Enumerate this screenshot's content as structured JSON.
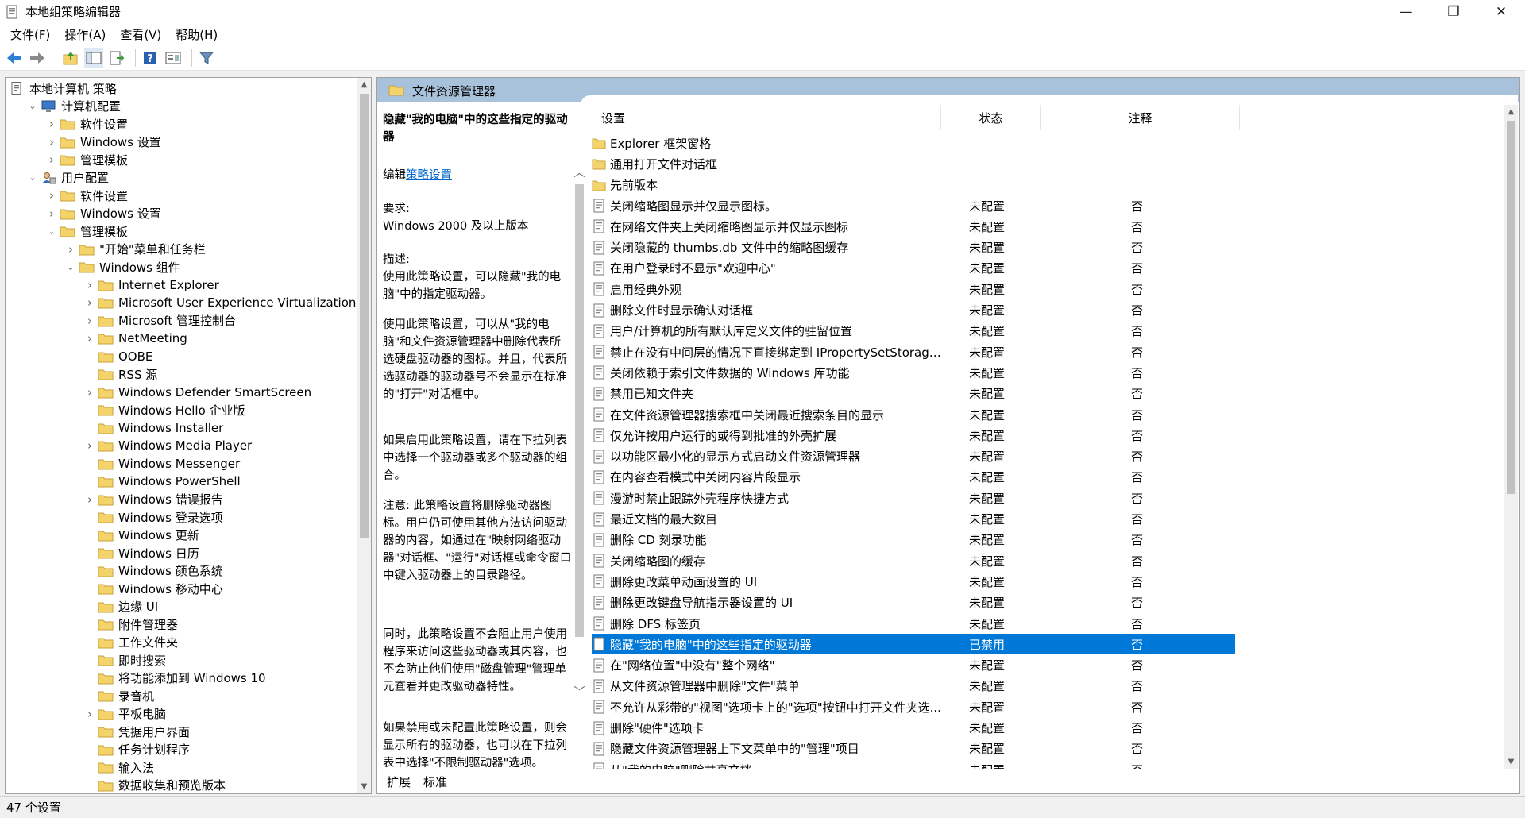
{
  "window": {
    "title": "本地组策略编辑器",
    "minimize": "—",
    "maximize": "❐",
    "close": "✕"
  },
  "menu": [
    "文件(F)",
    "操作(A)",
    "查看(V)",
    "帮助(H)"
  ],
  "tree": [
    {
      "label": "本地计算机 策略",
      "level": 0,
      "arrow": "",
      "icon": "policy-doc-icon"
    },
    {
      "label": "计算机配置",
      "level": 1,
      "arrow": "v",
      "icon": "computer-icon"
    },
    {
      "label": "软件设置",
      "level": 2,
      "arrow": ">",
      "icon": "folder-icon"
    },
    {
      "label": "Windows 设置",
      "level": 2,
      "arrow": ">",
      "icon": "folder-icon"
    },
    {
      "label": "管理模板",
      "level": 2,
      "arrow": ">",
      "icon": "folder-icon"
    },
    {
      "label": "用户配置",
      "level": 1,
      "arrow": "v",
      "icon": "user-icon"
    },
    {
      "label": "软件设置",
      "level": 2,
      "arrow": ">",
      "icon": "folder-icon"
    },
    {
      "label": "Windows 设置",
      "level": 2,
      "arrow": ">",
      "icon": "folder-icon"
    },
    {
      "label": "管理模板",
      "level": 2,
      "arrow": "v",
      "icon": "folder-icon"
    },
    {
      "label": "\"开始\"菜单和任务栏",
      "level": 3,
      "arrow": ">",
      "icon": "folder-icon"
    },
    {
      "label": "Windows 组件",
      "level": 3,
      "arrow": "v",
      "icon": "folder-icon"
    },
    {
      "label": "Internet Explorer",
      "level": 4,
      "arrow": ">",
      "icon": "folder-icon"
    },
    {
      "label": "Microsoft User Experience Virtualization",
      "level": 4,
      "arrow": ">",
      "icon": "folder-icon"
    },
    {
      "label": "Microsoft 管理控制台",
      "level": 4,
      "arrow": ">",
      "icon": "folder-icon"
    },
    {
      "label": "NetMeeting",
      "level": 4,
      "arrow": ">",
      "icon": "folder-icon"
    },
    {
      "label": "OOBE",
      "level": 4,
      "arrow": "",
      "icon": "folder-icon"
    },
    {
      "label": "RSS 源",
      "level": 4,
      "arrow": "",
      "icon": "folder-icon"
    },
    {
      "label": "Windows Defender SmartScreen",
      "level": 4,
      "arrow": ">",
      "icon": "folder-icon"
    },
    {
      "label": "Windows Hello 企业版",
      "level": 4,
      "arrow": "",
      "icon": "folder-icon"
    },
    {
      "label": "Windows Installer",
      "level": 4,
      "arrow": "",
      "icon": "folder-icon"
    },
    {
      "label": "Windows Media Player",
      "level": 4,
      "arrow": ">",
      "icon": "folder-icon"
    },
    {
      "label": "Windows Messenger",
      "level": 4,
      "arrow": "",
      "icon": "folder-icon"
    },
    {
      "label": "Windows PowerShell",
      "level": 4,
      "arrow": "",
      "icon": "folder-icon"
    },
    {
      "label": "Windows 错误报告",
      "level": 4,
      "arrow": ">",
      "icon": "folder-icon"
    },
    {
      "label": "Windows 登录选项",
      "level": 4,
      "arrow": "",
      "icon": "folder-icon"
    },
    {
      "label": "Windows 更新",
      "level": 4,
      "arrow": "",
      "icon": "folder-icon"
    },
    {
      "label": "Windows 日历",
      "level": 4,
      "arrow": "",
      "icon": "folder-icon"
    },
    {
      "label": "Windows 颜色系统",
      "level": 4,
      "arrow": "",
      "icon": "folder-icon"
    },
    {
      "label": "Windows 移动中心",
      "level": 4,
      "arrow": "",
      "icon": "folder-icon"
    },
    {
      "label": "边缘 UI",
      "level": 4,
      "arrow": "",
      "icon": "folder-icon"
    },
    {
      "label": "附件管理器",
      "level": 4,
      "arrow": "",
      "icon": "folder-icon"
    },
    {
      "label": "工作文件夹",
      "level": 4,
      "arrow": "",
      "icon": "folder-icon"
    },
    {
      "label": "即时搜索",
      "level": 4,
      "arrow": "",
      "icon": "folder-icon"
    },
    {
      "label": "将功能添加到 Windows 10",
      "level": 4,
      "arrow": "",
      "icon": "folder-icon"
    },
    {
      "label": "录音机",
      "level": 4,
      "arrow": "",
      "icon": "folder-icon"
    },
    {
      "label": "平板电脑",
      "level": 4,
      "arrow": ">",
      "icon": "folder-icon"
    },
    {
      "label": "凭据用户界面",
      "level": 4,
      "arrow": "",
      "icon": "folder-icon"
    },
    {
      "label": "任务计划程序",
      "level": 4,
      "arrow": "",
      "icon": "folder-icon"
    },
    {
      "label": "输入法",
      "level": 4,
      "arrow": "",
      "icon": "folder-icon"
    },
    {
      "label": "数据收集和预览版本",
      "level": 4,
      "arrow": "",
      "icon": "folder-icon"
    }
  ],
  "right": {
    "header_title": "文件资源管理器",
    "desc": {
      "title": "隐藏\"我的电脑\"中的这些指定的驱动器",
      "edit_prefix": "编辑",
      "edit_link": "策略设置",
      "req_label": "要求:",
      "req_value": "Windows 2000 及以上版本",
      "desc_label": "描述:",
      "p1": "使用此策略设置，可以隐藏\"我的电脑\"中的指定驱动器。",
      "p2": "使用此策略设置，可以从\"我的电脑\"和文件资源管理器中删除代表所选硬盘驱动器的图标。并且，代表所选驱动器的驱动器号不会显示在标准的\"打开\"对话框中。",
      "p3": "如果启用此策略设置，请在下拉列表中选择一个驱动器或多个驱动器的组合。",
      "p4": "注意: 此策略设置将删除驱动器图标。用户仍可使用其他方法访问驱动器的内容，如通过在\"映射网络驱动器\"对话框、\"运行\"对话框或命令窗口中键入驱动器上的目录路径。",
      "p5": "同时，此策略设置不会阻止用户使用程序来访问这些驱动器或其内容，也不会防止他们使用\"磁盘管理\"管理单元查看并更改驱动器特性。",
      "p6": "如果禁用或未配置此策略设置，则会显示所有的驱动器，也可以在下拉列表中选择\"不限制驱动器\"选项。"
    },
    "columns": {
      "setting": "设置",
      "state": "状态",
      "note": "注释"
    },
    "rows": [
      {
        "name": "Explorer 框架窗格",
        "state": "",
        "note": "",
        "type": "folder"
      },
      {
        "name": "通用打开文件对话框",
        "state": "",
        "note": "",
        "type": "folder"
      },
      {
        "name": "先前版本",
        "state": "",
        "note": "",
        "type": "folder"
      },
      {
        "name": "关闭缩略图显示并仅显示图标。",
        "state": "未配置",
        "note": "否",
        "type": "policy"
      },
      {
        "name": "在网络文件夹上关闭缩略图显示并仅显示图标",
        "state": "未配置",
        "note": "否",
        "type": "policy"
      },
      {
        "name": "关闭隐藏的 thumbs.db 文件中的缩略图缓存",
        "state": "未配置",
        "note": "否",
        "type": "policy"
      },
      {
        "name": "在用户登录时不显示\"欢迎中心\"",
        "state": "未配置",
        "note": "否",
        "type": "policy"
      },
      {
        "name": "启用经典外观",
        "state": "未配置",
        "note": "否",
        "type": "policy"
      },
      {
        "name": "删除文件时显示确认对话框",
        "state": "未配置",
        "note": "否",
        "type": "policy"
      },
      {
        "name": "用户/计算机的所有默认库定义文件的驻留位置",
        "state": "未配置",
        "note": "否",
        "type": "policy"
      },
      {
        "name": "禁止在没有中间层的情况下直接绑定到 IPropertySetStorage...",
        "state": "未配置",
        "note": "否",
        "type": "policy"
      },
      {
        "name": "关闭依赖于索引文件数据的 Windows 库功能",
        "state": "未配置",
        "note": "否",
        "type": "policy"
      },
      {
        "name": "禁用已知文件夹",
        "state": "未配置",
        "note": "否",
        "type": "policy"
      },
      {
        "name": "在文件资源管理器搜索框中关闭最近搜索条目的显示",
        "state": "未配置",
        "note": "否",
        "type": "policy"
      },
      {
        "name": "仅允许按用户运行的或得到批准的外壳扩展",
        "state": "未配置",
        "note": "否",
        "type": "policy"
      },
      {
        "name": "以功能区最小化的显示方式启动文件资源管理器",
        "state": "未配置",
        "note": "否",
        "type": "policy"
      },
      {
        "name": "在内容查看模式中关闭内容片段显示",
        "state": "未配置",
        "note": "否",
        "type": "policy"
      },
      {
        "name": "漫游时禁止跟踪外壳程序快捷方式",
        "state": "未配置",
        "note": "否",
        "type": "policy"
      },
      {
        "name": "最近文档的最大数目",
        "state": "未配置",
        "note": "否",
        "type": "policy"
      },
      {
        "name": "删除 CD 刻录功能",
        "state": "未配置",
        "note": "否",
        "type": "policy"
      },
      {
        "name": "关闭缩略图的缓存",
        "state": "未配置",
        "note": "否",
        "type": "policy"
      },
      {
        "name": "删除更改菜单动画设置的 UI",
        "state": "未配置",
        "note": "否",
        "type": "policy"
      },
      {
        "name": "删除更改键盘导航指示器设置的 UI",
        "state": "未配置",
        "note": "否",
        "type": "policy"
      },
      {
        "name": "删除 DFS 标签页",
        "state": "未配置",
        "note": "否",
        "type": "policy"
      },
      {
        "name": "隐藏\"我的电脑\"中的这些指定的驱动器",
        "state": "已禁用",
        "note": "否",
        "type": "policy",
        "selected": true
      },
      {
        "name": "在\"网络位置\"中没有\"整个网络\"",
        "state": "未配置",
        "note": "否",
        "type": "policy"
      },
      {
        "name": "从文件资源管理器中删除\"文件\"菜单",
        "state": "未配置",
        "note": "否",
        "type": "policy"
      },
      {
        "name": "不允许从彩带的\"视图\"选项卡上的\"选项\"按钮中打开文件夹选...",
        "state": "未配置",
        "note": "否",
        "type": "policy"
      },
      {
        "name": "删除\"硬件\"选项卡",
        "state": "未配置",
        "note": "否",
        "type": "policy"
      },
      {
        "name": "隐藏文件资源管理器上下文菜单中的\"管理\"项目",
        "state": "未配置",
        "note": "否",
        "type": "policy"
      },
      {
        "name": "从\"我的电脑\"删除共享文档",
        "state": "未配置",
        "note": "否",
        "type": "policy"
      }
    ],
    "tabs": [
      "扩展",
      "标准"
    ]
  },
  "status": "47 个设置",
  "colors": {
    "header": "#a9c2dc",
    "selected": "#0078d7",
    "folder": "#f5d36b",
    "link": "#0066cc"
  }
}
